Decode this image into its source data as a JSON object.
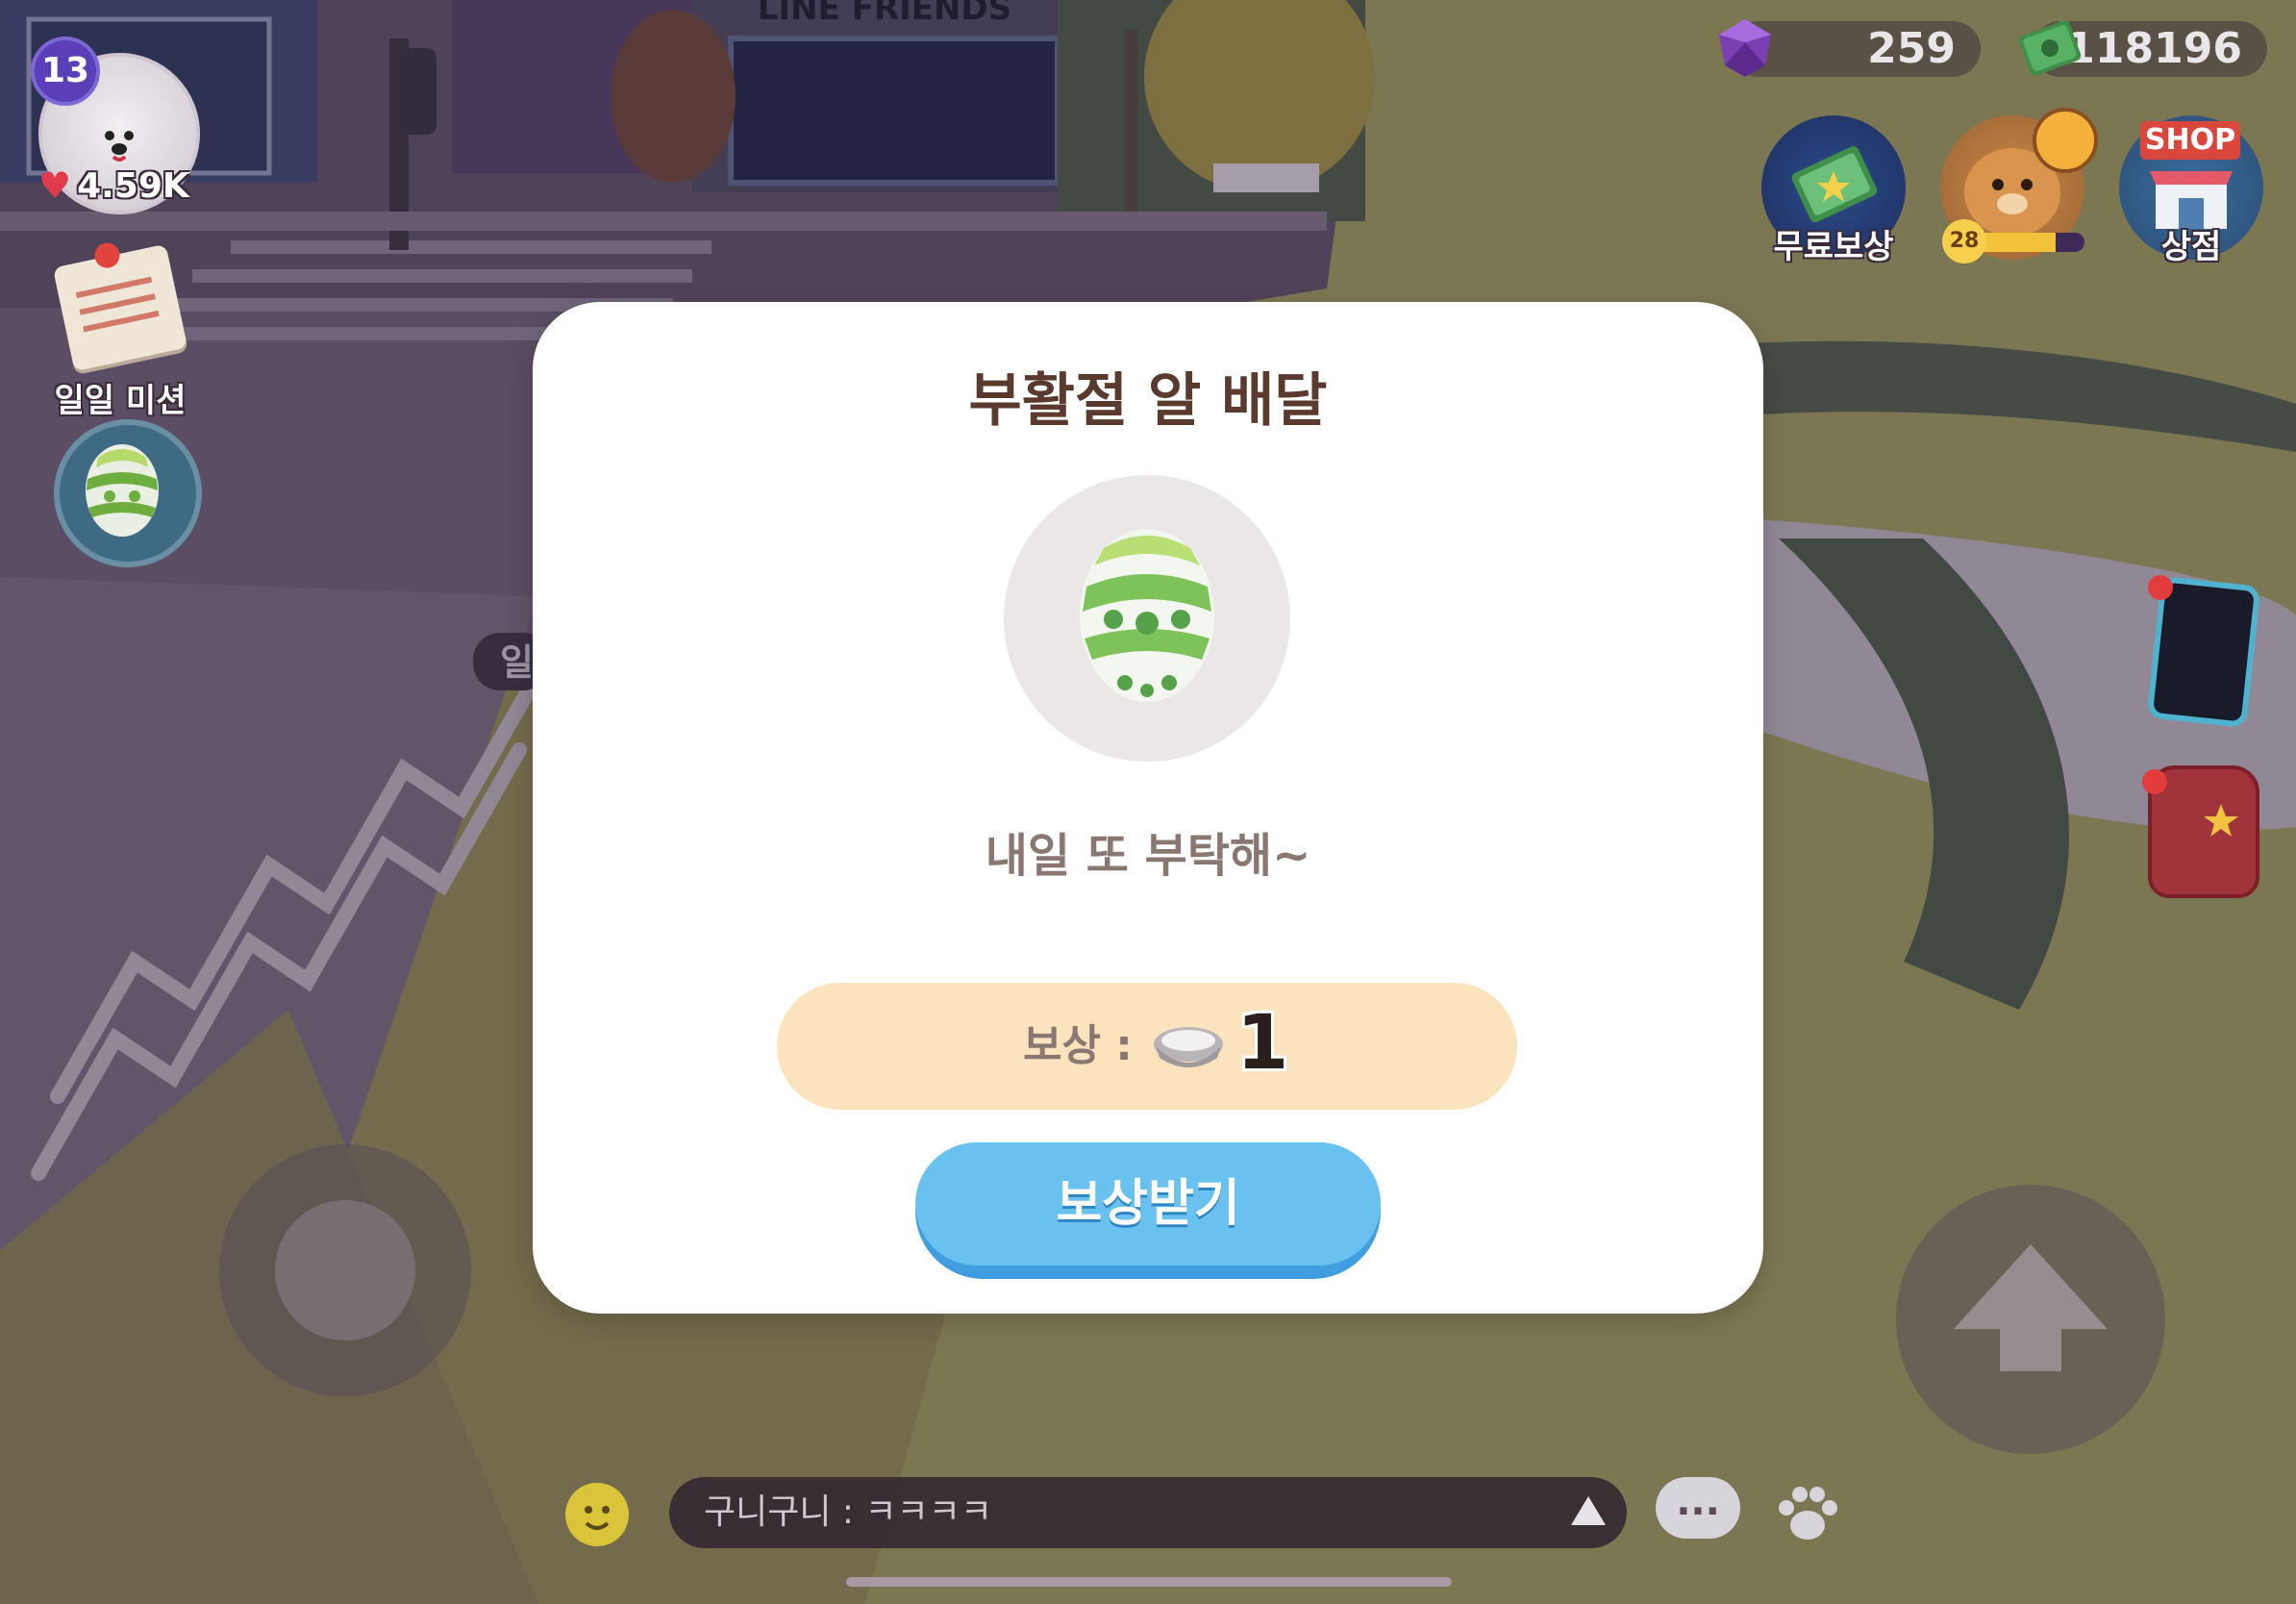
{
  "hud": {
    "level": "13",
    "likes": "4.59K",
    "daily_mission_label": "일일 미션",
    "gems": "259",
    "cash": "118196",
    "free_reward_label": "무료보상",
    "pet_level": "28",
    "pet_progress": 0.75,
    "shop_sign": "SHOP",
    "shop_label": "상점"
  },
  "background": {
    "store_sign": "LINE FRIENDS",
    "side_tag": "일"
  },
  "modal": {
    "title": "부활절 알 배달",
    "message": "내일 또 부탁해~",
    "reward_label": "보상 :",
    "reward_count": "1",
    "reward_icon": "bowl-icon",
    "claim_button": "보상받기"
  },
  "chat": {
    "message": "구니구니 : ㅋㅋㅋㅋ",
    "bubble_icon": "..."
  },
  "colors": {
    "modal_bg": "#ffffff",
    "title": "#5a3a2c",
    "reward_pill": "#fbe3bd",
    "button": "#69c1ef"
  }
}
